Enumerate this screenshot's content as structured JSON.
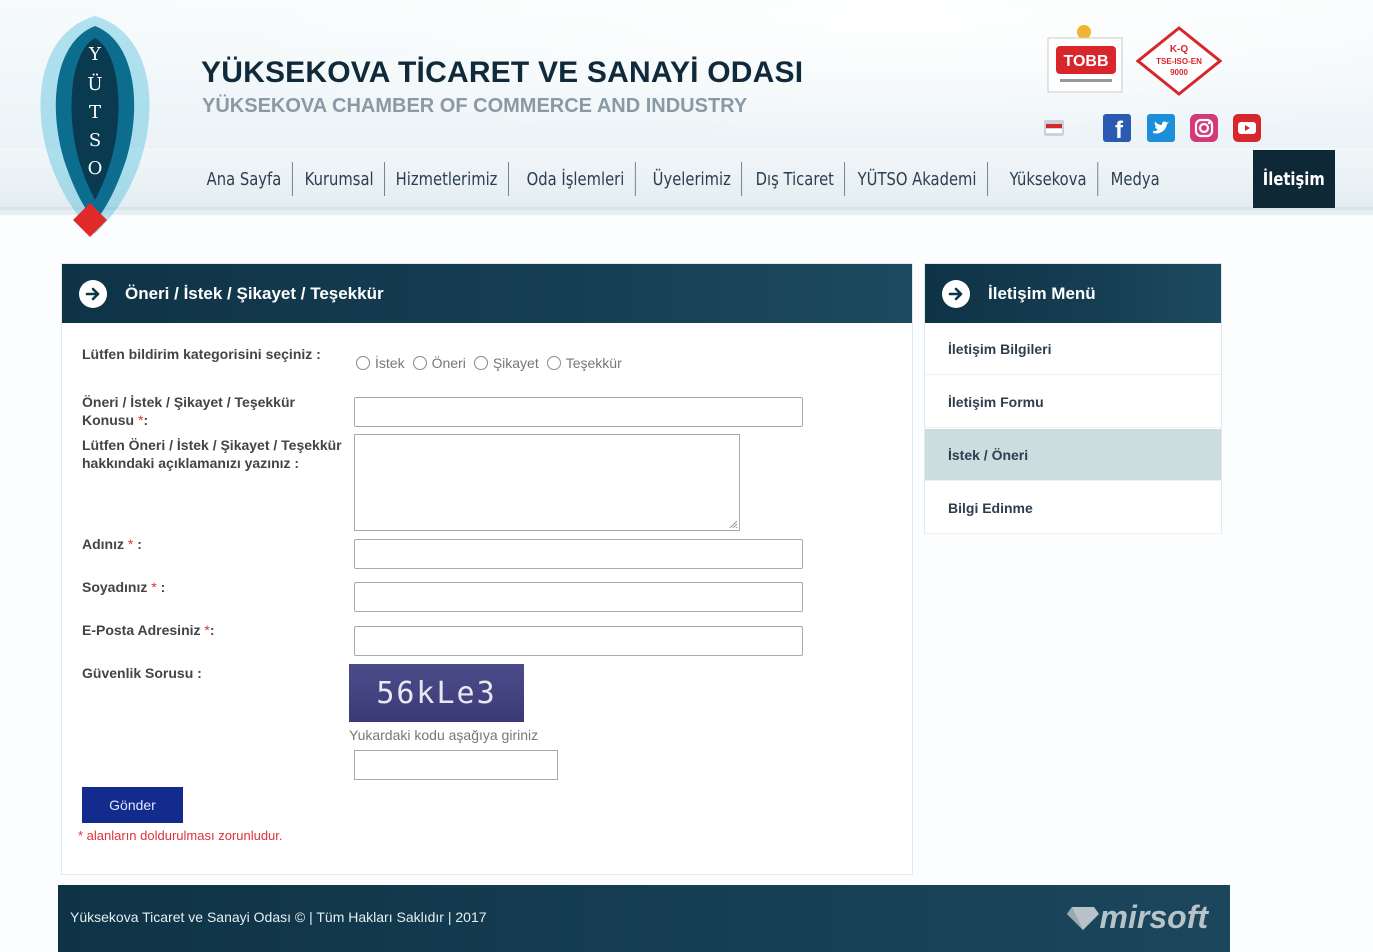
{
  "header": {
    "logo_letters": [
      "Y",
      "Ü",
      "T",
      "S",
      "O"
    ],
    "title": "YÜKSEKOVA TİCARET VE SANAYİ ODASI",
    "subtitle": "YÜKSEKOVA CHAMBER OF COMMERCE AND INDUSTRY",
    "tobb_label": "TOBB",
    "iso_label_1": "K-Q",
    "iso_label_2": "TSE-ISO-EN",
    "iso_label_3": "9000"
  },
  "social_icons": [
    "flag-icon",
    "facebook-icon",
    "twitter-icon",
    "instagram-icon",
    "youtube-icon"
  ],
  "nav": {
    "items": [
      "Ana Sayfa",
      "Kurumsal",
      "Hizmetlerimiz",
      "Oda İşlemleri",
      "Üyelerimiz",
      "Dış Ticaret",
      "YÜTSO Akademi",
      "Yüksekova",
      "Medya"
    ],
    "active": "İletişim"
  },
  "form": {
    "panel_title": "Öneri / İstek / Şikayet / Teşekkür",
    "category_label": "Lütfen bildirim kategorisini seçiniz :",
    "category_options": [
      "İstek",
      "Öneri",
      "Şikayet",
      "Teşekkür"
    ],
    "subject_label": "Öneri / İstek / Şikayet / Teşekkür Konusu",
    "description_label": "Lütfen Öneri / İstek / Şikayet / Teşekkür hakkındaki açıklamanızı yazınız :",
    "name_label": "Adınız",
    "surname_label": "Soyadınız",
    "email_label": "E-Posta Adresiniz",
    "security_label": "Güvenlik Sorusu :",
    "captcha_text": "56kLe3",
    "captcha_hint": "Yukardaki kodu aşağıya giriniz",
    "submit_label": "Gönder",
    "required_note": "* alanların doldurulması zorunludur.",
    "required_mark": "*",
    "colon": ":"
  },
  "side_menu": {
    "title": "İletişim Menü",
    "items": [
      "İletişim Bilgileri",
      "İletişim Formu",
      "İstek / Öneri",
      "Bilgi Edinme"
    ],
    "active_index": 2
  },
  "footer": {
    "copyright": "Yüksekova Ticaret ve Sanayi Odası © | Tüm Hakları Saklıdır | 2017",
    "brand": "mirsoft"
  },
  "colors": {
    "nav_active_bg": "#0f2836",
    "panel_header": "#0f3346",
    "submit_button": "#132b8c",
    "required": "#e0313a",
    "menu_active": "#cddcdf"
  }
}
